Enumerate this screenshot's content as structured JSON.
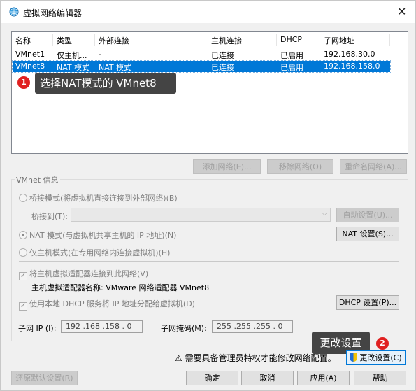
{
  "window": {
    "title": "虚拟网络编辑器",
    "close_glyph": "✕"
  },
  "table": {
    "headers": [
      "名称",
      "类型",
      "外部连接",
      "主机连接",
      "DHCP",
      "子网地址"
    ],
    "rows": [
      {
        "name": "VMnet1",
        "type": "仅主机...",
        "external": "-",
        "host": "已连接",
        "dhcp": "已启用",
        "subnet": "192.168.30.0"
      },
      {
        "name": "VMnet8",
        "type": "NAT 模式",
        "external": "NAT 模式",
        "host": "已连接",
        "dhcp": "已启用",
        "subnet": "192.168.158.0"
      }
    ]
  },
  "annotations": {
    "one": {
      "number": "1",
      "text": "选择NAT模式的 VMnet8"
    },
    "two": {
      "number": "2",
      "text": "更改设置"
    }
  },
  "table_buttons": {
    "add": "添加网络(E)...",
    "remove": "移除网络(O)",
    "rename": "重命名网络(A)..."
  },
  "vmnet_info": {
    "title": "VMnet 信息",
    "bridge_mode": "桥接模式(将虚拟机直接连接到外部网络)(B)",
    "bridge_to_label": "桥接到(T):",
    "auto_settings": "自动设置(U)...",
    "nat_mode": "NAT 模式(与虚拟机共享主机的 IP 地址)(N)",
    "nat_settings": "NAT 设置(S)...",
    "host_only": "仅主机模式(在专用网络内连接虚拟机)(H)",
    "connect_adapter": "将主机虚拟适配器连接到此网络(V)",
    "adapter_name": "主机虚拟适配器名称: VMware 网络适配器 VMnet8",
    "use_dhcp": "使用本地 DHCP 服务将 IP 地址分配给虚拟机(D)",
    "dhcp_settings": "DHCP 设置(P)...",
    "subnet_ip_label": "子网 IP (I):",
    "subnet_ip": "192 .168 .158 . 0",
    "subnet_mask_label": "子网掩码(M):",
    "subnet_mask": "255 .255 .255 . 0"
  },
  "footer": {
    "warning": "需要具备管理员特权才能修改网络配置。",
    "change_settings": "更改设置(C)",
    "restore": "还原默认设置(R)",
    "ok": "确定",
    "cancel": "取消",
    "apply": "应用(A)",
    "help": "帮助"
  },
  "colors": {
    "selection": "#0078d7",
    "badge": "#e02020",
    "callout": "#444444"
  }
}
